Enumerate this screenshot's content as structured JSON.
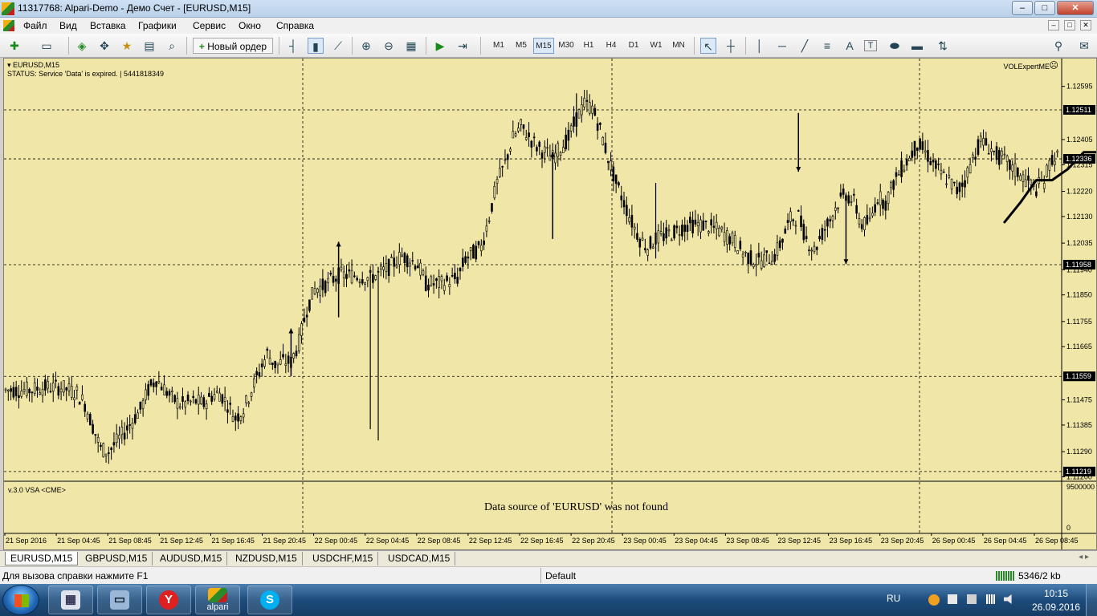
{
  "window": {
    "title": "11317768: Alpari-Demo - Демо Счет - [EURUSD,M15]",
    "buttons": [
      "–",
      "□",
      "✕"
    ]
  },
  "menu": {
    "items": [
      "Файл",
      "Вид",
      "Вставка",
      "Графики",
      "Сервис",
      "Окно",
      "Справка"
    ],
    "mdi_buttons": [
      "–",
      "□",
      "✕"
    ]
  },
  "toolbar": {
    "new_order": "Новый ордер",
    "timeframes": [
      "M1",
      "M5",
      "M15",
      "M30",
      "H1",
      "H4",
      "D1",
      "W1",
      "MN"
    ],
    "active_timeframe": "M15",
    "text_tool": "A",
    "label_tool": "T",
    "icons": [
      "new-chart-icon",
      "profiles-icon",
      "market-watch-icon",
      "navigator-icon",
      "data-window-icon",
      "terminal-icon",
      "strategy-tester-icon",
      "new-order-icon",
      "bar-chart-icon",
      "candlestick-icon",
      "line-chart-icon",
      "zoom-in-icon",
      "zoom-out-icon",
      "tile-windows-icon",
      "autoscroll-icon",
      "chart-shift-icon",
      "cursor-icon",
      "crosshair-icon",
      "vertical-line-icon",
      "horizontal-line-icon",
      "trendline-icon",
      "fibonacci-icon",
      "text-icon",
      "text-label-icon",
      "ellipse-icon",
      "rectangle-icon",
      "arrows-icon",
      "search-icon",
      "chat-icon"
    ]
  },
  "chart": {
    "symbol": "EURUSD,M15",
    "status": "STATUS:  Service 'Data' is expired.  |  5441818349",
    "expert": "VOLExpertME",
    "indicator_label": "v.3.0 VSA <CME>",
    "indicator_message": "Data source of 'EURUSD' was not found",
    "indicator_scale": [
      "9500000",
      "0"
    ],
    "colors": {
      "background": "#f0e6a8",
      "candles": "#000000",
      "price_tag_bg": "#000000",
      "price_tag_text": "#ffffff",
      "grid": "#000000"
    }
  },
  "chart_data": {
    "type": "candlestick",
    "symbol": "EURUSD",
    "timeframe": "M15",
    "ylim": [
      1.1119,
      1.1268
    ],
    "y_ticks": [
      "1.12595",
      "1.12405",
      "1.12315",
      "1.12220",
      "1.12130",
      "1.12035",
      "1.11940",
      "1.11850",
      "1.11755",
      "1.11665",
      "1.11475",
      "1.11385",
      "1.11290",
      "1.11200"
    ],
    "price_tags": [
      "1.12511",
      "1.12336",
      "1.11958",
      "1.11559",
      "1.11219"
    ],
    "x_ticks": [
      "21 Sep 2016",
      "21 Sep 04:45",
      "21 Sep 08:45",
      "21 Sep 12:45",
      "21 Sep 16:45",
      "21 Sep 20:45",
      "22 Sep 00:45",
      "22 Sep 04:45",
      "22 Sep 08:45",
      "22 Sep 12:45",
      "22 Sep 16:45",
      "22 Sep 20:45",
      "23 Sep 00:45",
      "23 Sep 04:45",
      "23 Sep 08:45",
      "23 Sep 12:45",
      "23 Sep 16:45",
      "23 Sep 20:45",
      "26 Sep 00:45",
      "26 Sep 04:45",
      "26 Sep 08:45"
    ],
    "close_path": [
      [
        0,
        1.1151
      ],
      [
        3,
        1.1151
      ],
      [
        5,
        1.1152
      ],
      [
        7,
        1.1152
      ],
      [
        9,
        1.115
      ],
      [
        10,
        1.1146
      ],
      [
        11,
        1.1138
      ],
      [
        12,
        1.113
      ],
      [
        13,
        1.1129
      ],
      [
        15,
        1.1136
      ],
      [
        17,
        1.1144
      ],
      [
        18,
        1.1151
      ],
      [
        19,
        1.1155
      ],
      [
        21,
        1.1148
      ],
      [
        22,
        1.1146
      ],
      [
        24,
        1.1147
      ],
      [
        25,
        1.1146
      ],
      [
        26,
        1.1149
      ],
      [
        27,
        1.115
      ],
      [
        28,
        1.1146
      ],
      [
        29,
        1.1141
      ],
      [
        30,
        1.1144
      ],
      [
        31,
        1.1151
      ],
      [
        33,
        1.1164
      ],
      [
        34,
        1.116
      ],
      [
        35,
        1.1161
      ],
      [
        36,
        1.1161
      ],
      [
        37,
        1.1168
      ],
      [
        38,
        1.118
      ],
      [
        39,
        1.1187
      ],
      [
        40,
        1.1188
      ],
      [
        42,
        1.1192
      ],
      [
        44,
        1.1192
      ],
      [
        46,
        1.1191
      ],
      [
        48,
        1.1194
      ],
      [
        50,
        1.1199
      ],
      [
        52,
        1.1196
      ],
      [
        53,
        1.1189
      ],
      [
        55,
        1.1189
      ],
      [
        57,
        1.1191
      ],
      [
        58,
        1.1198
      ],
      [
        60,
        1.1202
      ],
      [
        61,
        1.1213
      ],
      [
        62,
        1.1225
      ],
      [
        63,
        1.1232
      ],
      [
        64,
        1.1241
      ],
      [
        65,
        1.1245
      ],
      [
        67,
        1.1238
      ],
      [
        69,
        1.1234
      ],
      [
        71,
        1.1241
      ],
      [
        72,
        1.1248
      ],
      [
        73,
        1.1253
      ],
      [
        74,
        1.1252
      ],
      [
        75,
        1.1244
      ],
      [
        76,
        1.1234
      ],
      [
        77,
        1.1225
      ],
      [
        78,
        1.1218
      ],
      [
        79,
        1.1211
      ],
      [
        80,
        1.1205
      ],
      [
        81,
        1.1202
      ],
      [
        82,
        1.1205
      ],
      [
        84,
        1.1207
      ],
      [
        86,
        1.121
      ],
      [
        88,
        1.121
      ],
      [
        90,
        1.1208
      ],
      [
        92,
        1.1204
      ],
      [
        93,
        1.12
      ],
      [
        94,
        1.1198
      ],
      [
        95,
        1.1197
      ],
      [
        97,
        1.1199
      ],
      [
        98,
        1.1205
      ],
      [
        99,
        1.1212
      ],
      [
        100,
        1.1213
      ],
      [
        101,
        1.1205
      ],
      [
        102,
        1.1201
      ],
      [
        103,
        1.1207
      ],
      [
        104,
        1.1212
      ],
      [
        105,
        1.1218
      ],
      [
        106,
        1.1221
      ],
      [
        107,
        1.1218
      ],
      [
        108,
        1.121
      ],
      [
        109,
        1.1211
      ],
      [
        110,
        1.122
      ],
      [
        111,
        1.1218
      ],
      [
        112,
        1.1225
      ],
      [
        113,
        1.123
      ],
      [
        114,
        1.1234
      ],
      [
        115,
        1.1239
      ],
      [
        116,
        1.1236
      ],
      [
        117,
        1.1232
      ],
      [
        118,
        1.1228
      ],
      [
        119,
        1.1226
      ],
      [
        120,
        1.1222
      ],
      [
        121,
        1.1226
      ],
      [
        122,
        1.1234
      ],
      [
        123,
        1.124
      ],
      [
        124,
        1.1238
      ],
      [
        125,
        1.1235
      ],
      [
        126,
        1.1233
      ],
      [
        127,
        1.123
      ],
      [
        128,
        1.1228
      ],
      [
        129,
        1.1225
      ],
      [
        130,
        1.1223
      ],
      [
        131,
        1.1226
      ],
      [
        132,
        1.1234
      ]
    ],
    "long_wicks": [
      [
        46,
        1.1137,
        1.1194
      ],
      [
        47,
        1.1133,
        1.1195
      ],
      [
        72,
        1.1257,
        1.1242
      ],
      [
        82,
        1.1198,
        1.1225
      ]
    ],
    "arrows": [
      {
        "direction": "up",
        "bar": 36,
        "from": 1.1156,
        "to": 1.1173
      },
      {
        "direction": "up",
        "bar": 42,
        "from": 1.1177,
        "to": 1.1204
      },
      {
        "direction": "up",
        "bar": 69,
        "from": 1.1205,
        "to": 1.1236
      },
      {
        "direction": "down",
        "bar": 100,
        "from": 1.125,
        "to": 1.1229
      },
      {
        "direction": "down",
        "bar": 106,
        "from": 1.1221,
        "to": 1.1196
      }
    ],
    "drawn_curve": [
      [
        126,
        1.1211
      ],
      [
        128,
        1.1218
      ],
      [
        130,
        1.1226
      ],
      [
        132,
        1.1226
      ],
      [
        134,
        1.123
      ],
      [
        136,
        1.1236
      ],
      [
        138,
        1.1236
      ],
      [
        140,
        1.1238
      ],
      [
        142,
        1.124
      ],
      [
        144,
        1.1242
      ],
      [
        146,
        1.1244
      ],
      [
        148,
        1.1246
      ],
      [
        150,
        1.1248
      ],
      [
        152,
        1.1252
      ],
      [
        154,
        1.125
      ],
      [
        156,
        1.1246
      ],
      [
        158,
        1.1244
      ],
      [
        160,
        1.1245
      ],
      [
        162,
        1.1248
      ],
      [
        164,
        1.1249
      ],
      [
        166,
        1.1247
      ]
    ]
  },
  "tabs": {
    "items": [
      "EURUSD,M15",
      "GBPUSD,M15",
      "AUDUSD,M15",
      "NZDUSD,M15",
      "USDCHF,M15",
      "USDCAD,M15"
    ],
    "active": "EURUSD,M15",
    "arrows": "◂ ▸"
  },
  "statusbar": {
    "help": "Для вызова справки нажмите F1",
    "profile": "Default",
    "traffic": "5346/2 kb"
  },
  "taskbar": {
    "apps": [
      {
        "name": "calculator-icon",
        "label": ""
      },
      {
        "name": "computer-icon",
        "label": ""
      },
      {
        "name": "yandex-icon",
        "label": "",
        "glyph": "Y"
      },
      {
        "name": "alpari-icon",
        "label": "alpari"
      },
      {
        "name": "skype-icon",
        "label": "",
        "glyph": "S"
      }
    ],
    "lang": "RU",
    "time": "10:15",
    "date": "26.09.2016"
  }
}
